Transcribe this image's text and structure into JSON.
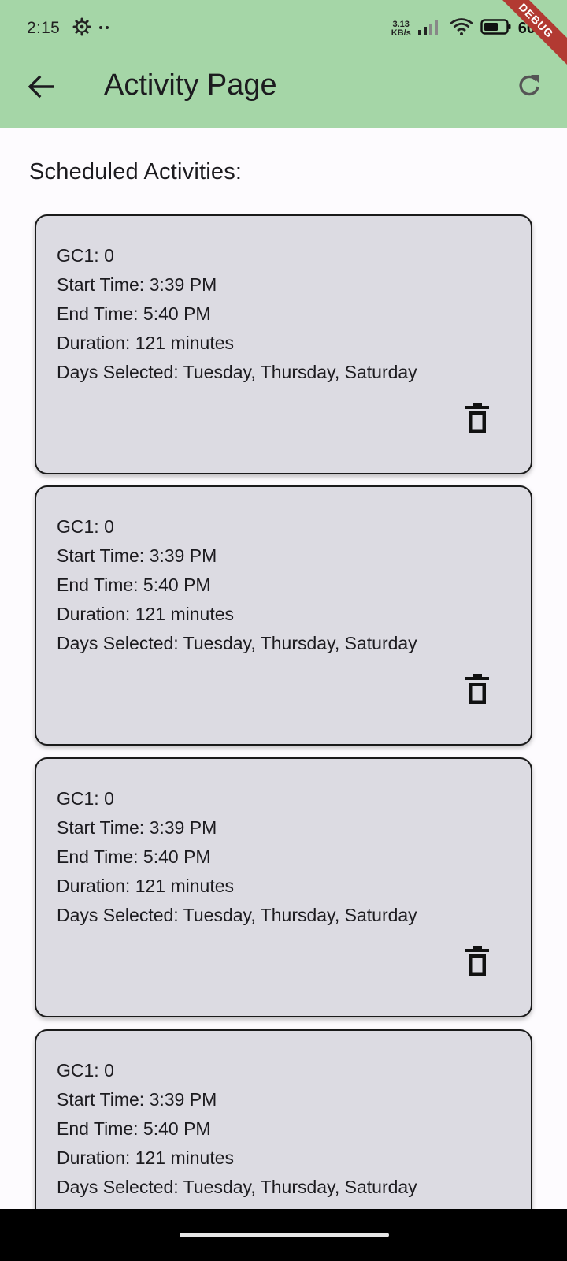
{
  "status_bar": {
    "time": "2:15",
    "net_speed_value": "3.13",
    "net_speed_unit": "KB/s",
    "battery": "60"
  },
  "debug_banner": "DEBUG",
  "app_bar": {
    "title": "Activity Page",
    "back_icon": "arrow-back-icon",
    "refresh_icon": "refresh-icon",
    "color": "#a5d6a7"
  },
  "section_title": "Scheduled Activities:",
  "activities": [
    {
      "gc1": "GC1: 0",
      "start": "Start Time: 3:39 PM",
      "end": "End Time: 5:40 PM",
      "duration": "Duration: 121 minutes",
      "days": "Days Selected: Tuesday, Thursday, Saturday"
    },
    {
      "gc1": "GC1: 0",
      "start": "Start Time: 3:39 PM",
      "end": "End Time: 5:40 PM",
      "duration": "Duration: 121 minutes",
      "days": "Days Selected: Tuesday, Thursday, Saturday"
    },
    {
      "gc1": "GC1: 0",
      "start": "Start Time: 3:39 PM",
      "end": "End Time: 5:40 PM",
      "duration": "Duration: 121 minutes",
      "days": "Days Selected: Tuesday, Thursday, Saturday"
    },
    {
      "gc1": "GC1: 0",
      "start": "Start Time: 3:39 PM",
      "end": "End Time: 5:40 PM",
      "duration": "Duration: 121 minutes",
      "days": "Days Selected: Tuesday, Thursday, Saturday"
    }
  ],
  "colors": {
    "card_background": "#dcdbe2",
    "page_background": "#fdfbfe"
  }
}
